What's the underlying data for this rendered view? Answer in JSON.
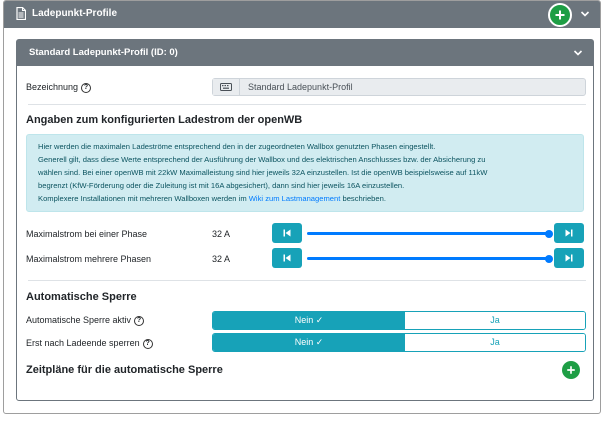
{
  "outer": {
    "title": "Ladepunkt-Profile"
  },
  "profile": {
    "title": "Standard Ladepunkt-Profil (ID: 0)",
    "name_label": "Bezeichnung",
    "name_value": "Standard Ladepunkt-Profil"
  },
  "current": {
    "heading": "Angaben zum konfigurierten Ladestrom der openWB",
    "info_lines": [
      "Hier werden die maximalen Ladeströme entsprechend den in der zugeordneten Wallbox genutzten Phasen eingestellt.",
      "Generell gilt, dass diese Werte entsprechend der Ausführung der Wallbox und des elektrischen Anschlusses bzw. der Absicherung zu",
      "wählen sind. Bei einer openWB mit 22kW Maximalleistung sind hier jeweils 32A einzustellen. Ist die openWB beispielsweise auf 11kW",
      "begrenzt (KfW-Förderung oder die Zuleitung ist mit 16A abgesichert), dann sind hier jeweils 16A einzustellen."
    ],
    "info_last_prefix": "Komplexere Installationen mit mehreren Wallboxen werden im ",
    "info_link": "Wiki zum Lastmanagement",
    "info_last_suffix": " beschrieben.",
    "single_phase": {
      "label": "Maximalstrom bei einer Phase",
      "value_text": "32 A",
      "fraction": 1.0
    },
    "multi_phase": {
      "label": "Maximalstrom mehrere Phasen",
      "value_text": "32 A",
      "fraction": 1.0
    }
  },
  "lock": {
    "heading": "Automatische Sperre",
    "active": {
      "label": "Automatische Sperre aktiv",
      "option_a": "Nein",
      "option_b": "Ja",
      "selected": "Nein"
    },
    "after_charge": {
      "label": "Erst nach Ladeende sperren",
      "option_a": "Nein",
      "option_b": "Ja",
      "selected": "Nein"
    }
  },
  "schedule": {
    "heading": "Zeitpläne für die automatische Sperre"
  },
  "colors": {
    "header": "#6c757d",
    "info": "#17a2b8",
    "slider": "#007bff",
    "add": "#1e9e45"
  }
}
